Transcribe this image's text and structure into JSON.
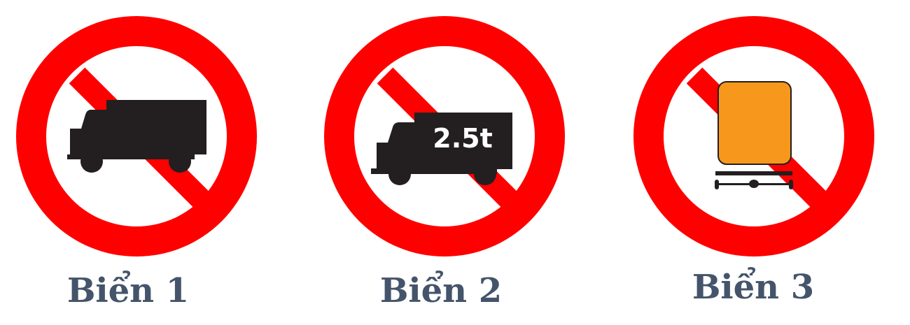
{
  "signs": [
    {
      "caption": "Biển 1",
      "icon": "no-trucks-icon"
    },
    {
      "caption": "Biển 2",
      "icon": "no-trucks-over-weight-icon",
      "weight_label": "2.5t"
    },
    {
      "caption": "Biển 3",
      "icon": "no-trailers-icon"
    }
  ],
  "colors": {
    "ring_red": "#ff0000",
    "symbol_black": "#231f20",
    "trailer_orange": "#f7981d",
    "caption_text": "#44546a",
    "background": "#ffffff"
  }
}
